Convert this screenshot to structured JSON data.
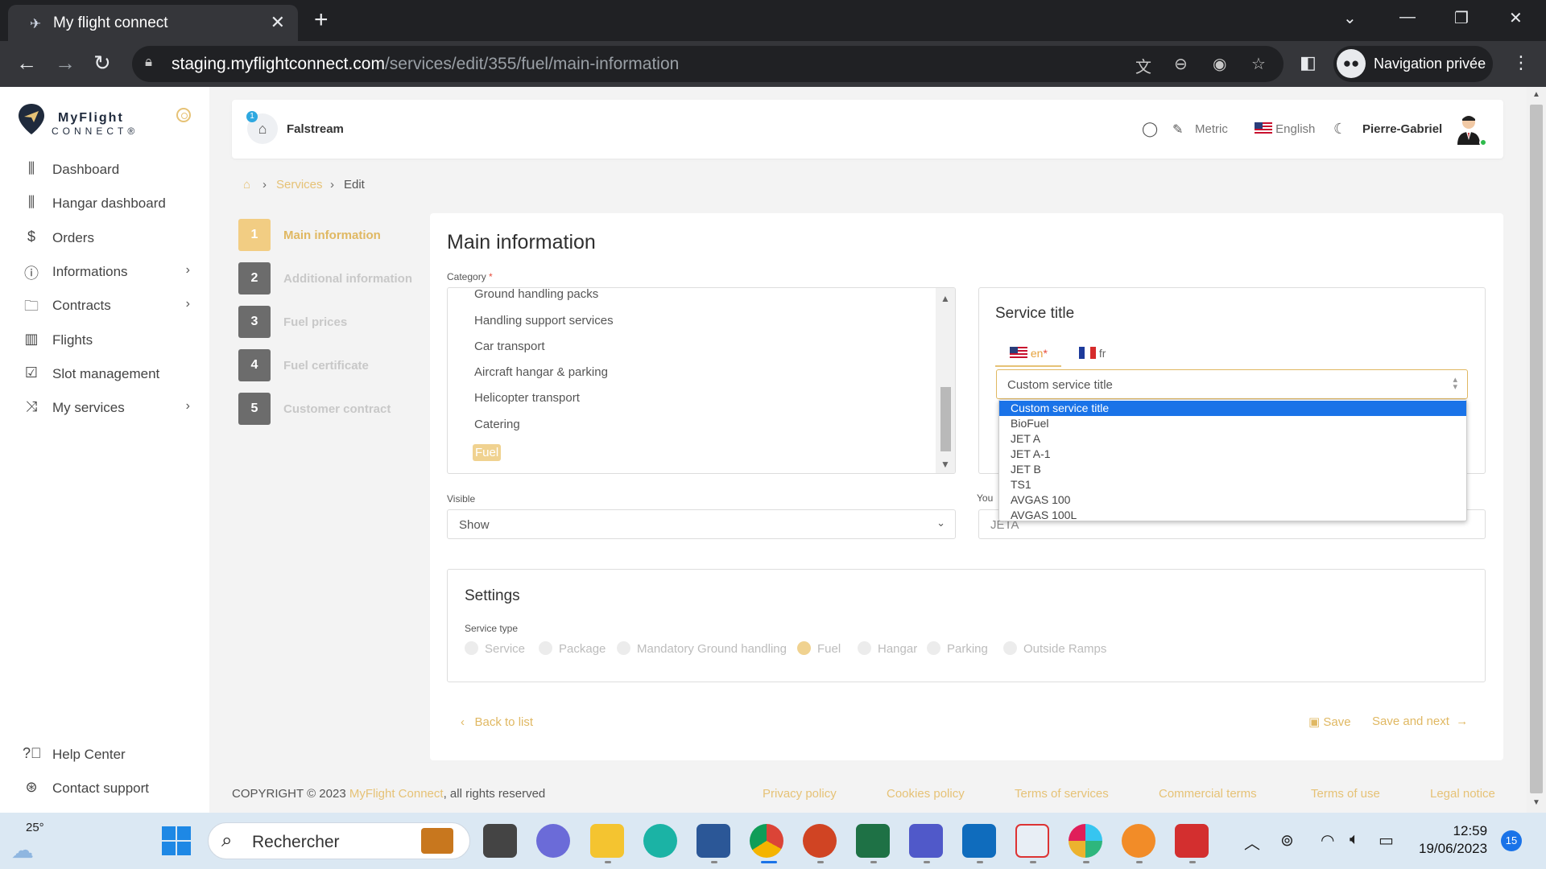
{
  "browser": {
    "tab_title": "My flight connect",
    "url_domain": "staging.myflightconnect.com",
    "url_path": "/services/edit/355/fuel/main-information",
    "profile_label": "Navigation privée"
  },
  "sidebar": {
    "logo_line1": "MyFlight",
    "logo_line2": "CONNECT®",
    "items": [
      {
        "label": "Dashboard",
        "icon": "bar-chart-icon"
      },
      {
        "label": "Hangar dashboard",
        "icon": "bar-chart-icon"
      },
      {
        "label": "Orders",
        "icon": "dollar-icon"
      },
      {
        "label": "Informations",
        "icon": "info-icon"
      },
      {
        "label": "Contracts",
        "icon": "folder-icon"
      },
      {
        "label": "Flights",
        "icon": "luggage-icon"
      },
      {
        "label": "Slot management",
        "icon": "calendar-check-icon"
      },
      {
        "label": "My services",
        "icon": "shuffle-icon"
      }
    ],
    "bottom_items": [
      {
        "label": "Help Center",
        "icon": "help-icon"
      },
      {
        "label": "Contact support",
        "icon": "lifebuoy-icon"
      }
    ]
  },
  "header": {
    "badge": "1",
    "org_name": "Falstream",
    "units": "Metric",
    "language": "English",
    "user_name": "Pierre-Gabriel"
  },
  "breadcrumb": {
    "services": "Services",
    "edit": "Edit"
  },
  "steps": [
    {
      "num": "1",
      "label": "Main information",
      "active": true
    },
    {
      "num": "2",
      "label": "Additional information"
    },
    {
      "num": "3",
      "label": "Fuel prices"
    },
    {
      "num": "4",
      "label": "Fuel certificate"
    },
    {
      "num": "5",
      "label": "Customer contract"
    }
  ],
  "main": {
    "title": "Main information",
    "category_label": "Category",
    "required_mark": "*",
    "category_options": [
      "Ground handling packs",
      "Handling support services",
      "Car transport",
      "Aircraft hangar & parking",
      "Helicopter transport",
      "Catering"
    ],
    "category_selected": "Fuel",
    "visible_label": "Visible",
    "visible_value": "Show",
    "service_title": {
      "heading": "Service title",
      "lang_en": "en",
      "lang_fr": "fr",
      "selected": "Custom service title",
      "options": [
        "Custom service title",
        "BioFuel",
        "JET A",
        "JET A-1",
        "JET B",
        "TS1",
        "AVGAS 100",
        "AVGAS 100L"
      ]
    },
    "partial_label": "You",
    "partial_value": "JETA",
    "settings": {
      "heading": "Settings",
      "service_type_label": "Service type",
      "types": [
        "Service",
        "Package",
        "Mandatory Ground handling",
        "Fuel",
        "Hangar",
        "Parking",
        "Outside Ramps"
      ],
      "selected_type": "Fuel"
    },
    "back_label": "Back to list",
    "save_label": "Save",
    "save_next_label": "Save and next"
  },
  "footer": {
    "copyright": "COPYRIGHT © 2023",
    "brand": "MyFlight Connect",
    "rights": ", all rights reserved",
    "links": [
      "Privacy policy",
      "Cookies policy",
      "Terms of services",
      "Commercial terms",
      "Terms of use",
      "Legal notice"
    ]
  },
  "taskbar": {
    "temperature": "25°",
    "search_placeholder": "Rechercher",
    "time": "12:59",
    "date": "19/06/2023",
    "notifications": "15"
  },
  "colors": {
    "accent": "#e6c276",
    "selected_option": "#1a73e8",
    "step_inactive": "#6c6c6c"
  }
}
